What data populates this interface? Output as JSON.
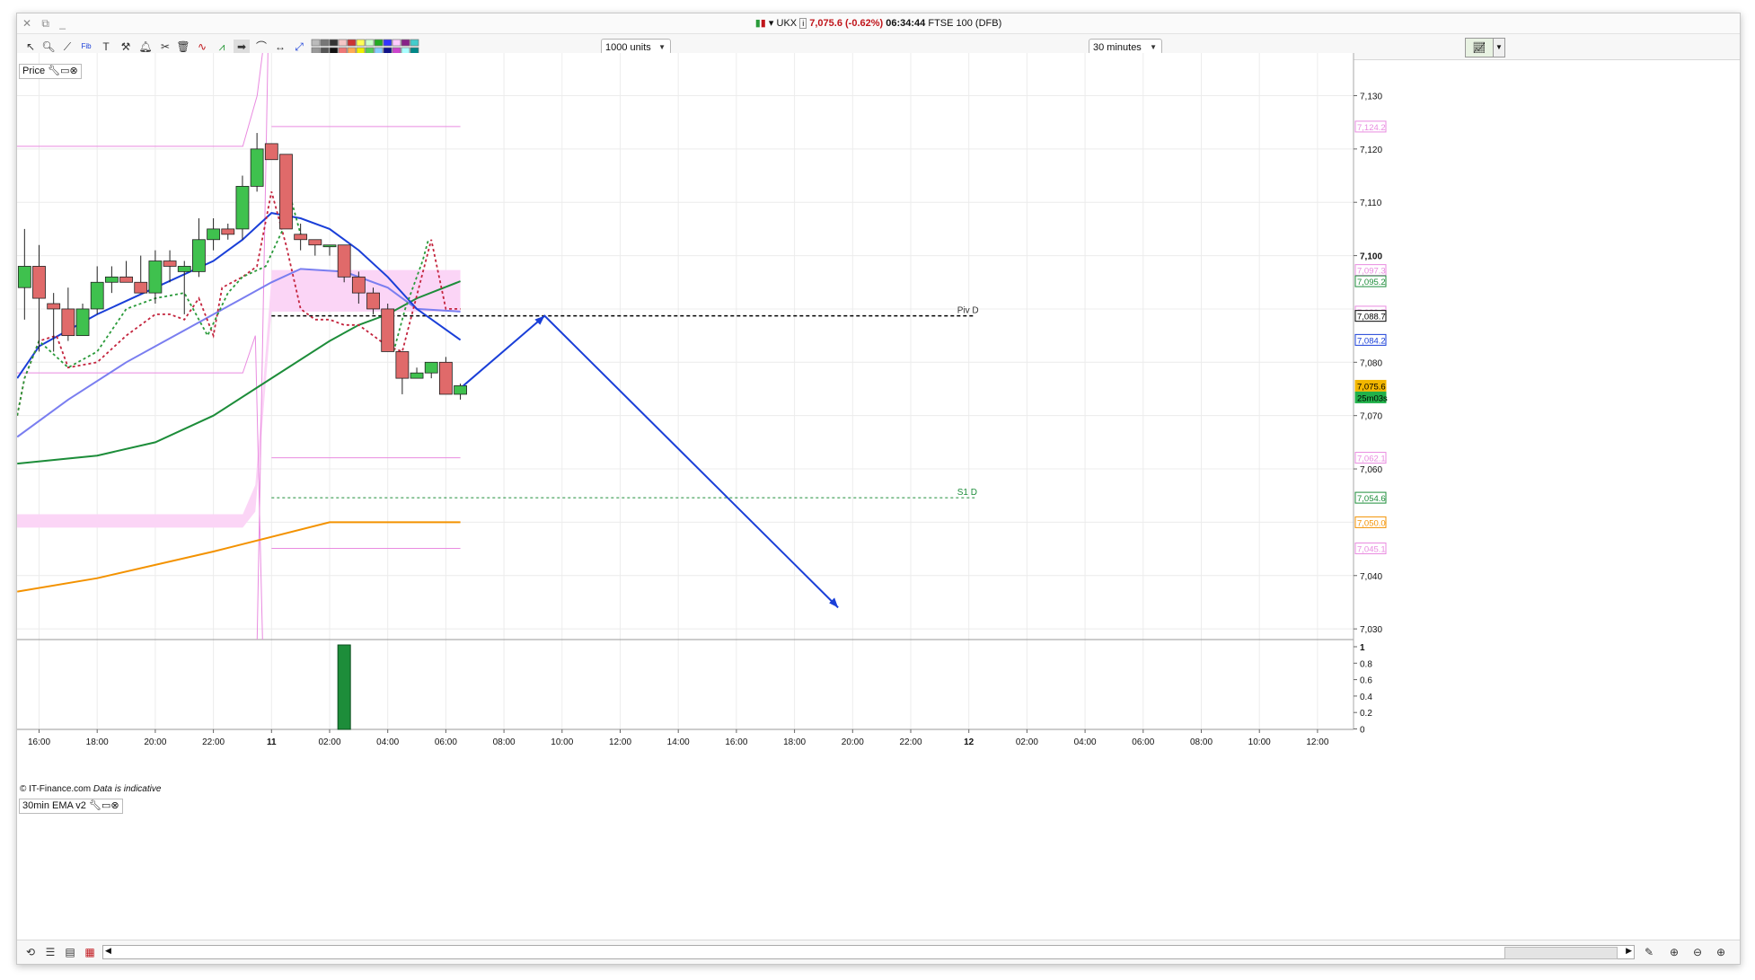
{
  "title_bar": {
    "symbol": "UKX",
    "price_change": "7,075.6 (-0.62%)",
    "time": "06:34:44",
    "instrument": "FTSE 100 (DFB)"
  },
  "toolbar": {
    "units_select": "1000 units",
    "interval_select": "30 minutes"
  },
  "price_panel": {
    "label": "Price",
    "watermark": "© IT-Finance.com",
    "watermark_note": "Data is indicative"
  },
  "indicator_panel": {
    "label": "30min EMA v2"
  },
  "price_axis": {
    "ticks": [
      "7,130",
      "7,120",
      "7,110",
      "7,100",
      "7,080",
      "7,070",
      "7,060",
      "7,040",
      "7,030"
    ],
    "markers": [
      {
        "label": "7,124.2",
        "color": "#e98be0"
      },
      {
        "label": "7,097.3",
        "color": "#e98be0"
      },
      {
        "label": "7,095.2",
        "color": "#1d8d3a"
      },
      {
        "label": "7,089.5",
        "color": "#e98be0"
      },
      {
        "label": "7,088.7",
        "color": "#000000"
      },
      {
        "label": "7,084.2",
        "color": "#1a3fd8"
      },
      {
        "label": "7,075.6",
        "color": "#f2b600"
      },
      {
        "label": "25m03s",
        "color": "#21b14a"
      },
      {
        "label": "7,062.1",
        "color": "#e98be0"
      },
      {
        "label": "7,054.6",
        "color": "#1d8d3a"
      },
      {
        "label": "7,050.0",
        "color": "#f39200"
      },
      {
        "label": "7,045.1",
        "color": "#e98be0"
      }
    ]
  },
  "indicator_axis": {
    "ticks": [
      "1",
      "0.8",
      "0.6",
      "0.4",
      "0.2",
      "0"
    ]
  },
  "time_axis": {
    "labels": [
      "16:00",
      "18:00",
      "20:00",
      "22:00",
      "11",
      "02:00",
      "04:00",
      "06:00",
      "08:00",
      "10:00",
      "12:00",
      "14:00",
      "16:00",
      "18:00",
      "20:00",
      "22:00",
      "12",
      "02:00",
      "04:00",
      "06:00",
      "08:00",
      "10:00",
      "12:00"
    ]
  },
  "pivot_labels": {
    "pivot": "Piv D",
    "support": "S1 D"
  },
  "colors": {
    "bull": "#3fc14e",
    "bear": "#e06a6a",
    "ema_fast": "#1a3fd8",
    "ema_mid": "#7a7ef0",
    "ema_slow": "#1d8d3a",
    "ema_long": "#f39200",
    "bands": "#e98be0",
    "arrow": "#1a3fd8"
  },
  "chart_data": {
    "type": "candlestick",
    "interval": "30 minutes",
    "ylim": [
      7028,
      7138
    ],
    "candles": [
      {
        "t": "15:30",
        "o": 7094,
        "h": 7105,
        "l": 7088,
        "c": 7098
      },
      {
        "t": "16:00",
        "o": 7098,
        "h": 7102,
        "l": 7082,
        "c": 7092
      },
      {
        "t": "16:30",
        "o": 7091,
        "h": 7093,
        "l": 7082,
        "c": 7090
      },
      {
        "t": "17:00",
        "o": 7090,
        "h": 7094,
        "l": 7084,
        "c": 7085
      },
      {
        "t": "17:30",
        "o": 7085,
        "h": 7091,
        "l": 7085,
        "c": 7090
      },
      {
        "t": "18:00",
        "o": 7090,
        "h": 7098,
        "l": 7089,
        "c": 7095
      },
      {
        "t": "18:30",
        "o": 7095,
        "h": 7098,
        "l": 7093,
        "c": 7096
      },
      {
        "t": "19:00",
        "o": 7096,
        "h": 7099,
        "l": 7095,
        "c": 7095
      },
      {
        "t": "19:30",
        "o": 7095,
        "h": 7100,
        "l": 7093,
        "c": 7093
      },
      {
        "t": "20:00",
        "o": 7093,
        "h": 7101,
        "l": 7091,
        "c": 7099
      },
      {
        "t": "20:30",
        "o": 7099,
        "h": 7101,
        "l": 7095,
        "c": 7098
      },
      {
        "t": "21:00",
        "o": 7097,
        "h": 7099,
        "l": 7089,
        "c": 7098
      },
      {
        "t": "21:30",
        "o": 7097,
        "h": 7107,
        "l": 7096,
        "c": 7103
      },
      {
        "t": "22:00",
        "o": 7103,
        "h": 7107,
        "l": 7101,
        "c": 7105
      },
      {
        "t": "22:30",
        "o": 7105,
        "h": 7106,
        "l": 7103,
        "c": 7104
      },
      {
        "t": "23:00",
        "o": 7105,
        "h": 7115,
        "l": 7103,
        "c": 7113
      },
      {
        "t": "23:30",
        "o": 7113,
        "h": 7123,
        "l": 7112,
        "c": 7120
      },
      {
        "t": "00:00",
        "o": 7121,
        "h": 7121,
        "l": 7118,
        "c": 7118
      },
      {
        "t": "00:30",
        "o": 7119,
        "h": 7119,
        "l": 7105,
        "c": 7105
      },
      {
        "t": "01:00",
        "o": 7104,
        "h": 7106,
        "l": 7101,
        "c": 7103
      },
      {
        "t": "01:30",
        "o": 7103,
        "h": 7103,
        "l": 7100,
        "c": 7102
      },
      {
        "t": "02:00",
        "o": 7102,
        "h": 7102,
        "l": 7100,
        "c": 7102
      },
      {
        "t": "02:30",
        "o": 7102,
        "h": 7102,
        "l": 7095,
        "c": 7096
      },
      {
        "t": "03:00",
        "o": 7096,
        "h": 7097,
        "l": 7091,
        "c": 7093
      },
      {
        "t": "03:30",
        "o": 7093,
        "h": 7094,
        "l": 7089,
        "c": 7090
      },
      {
        "t": "04:00",
        "o": 7090,
        "h": 7091,
        "l": 7082,
        "c": 7082
      },
      {
        "t": "04:30",
        "o": 7082,
        "h": 7082,
        "l": 7074,
        "c": 7077
      },
      {
        "t": "05:00",
        "o": 7077,
        "h": 7079,
        "l": 7077,
        "c": 7078
      },
      {
        "t": "05:30",
        "o": 7078,
        "h": 7080,
        "l": 7077,
        "c": 7080
      },
      {
        "t": "06:00",
        "o": 7080,
        "h": 7081,
        "l": 7074,
        "c": 7074
      },
      {
        "t": "06:30",
        "o": 7074,
        "h": 7076,
        "l": 7073,
        "c": 7075.6
      }
    ],
    "levels": {
      "pivot": 7088.7,
      "s1": 7054.6
    },
    "indicator": {
      "type": "bar",
      "value": 1,
      "at": "02:30"
    }
  }
}
